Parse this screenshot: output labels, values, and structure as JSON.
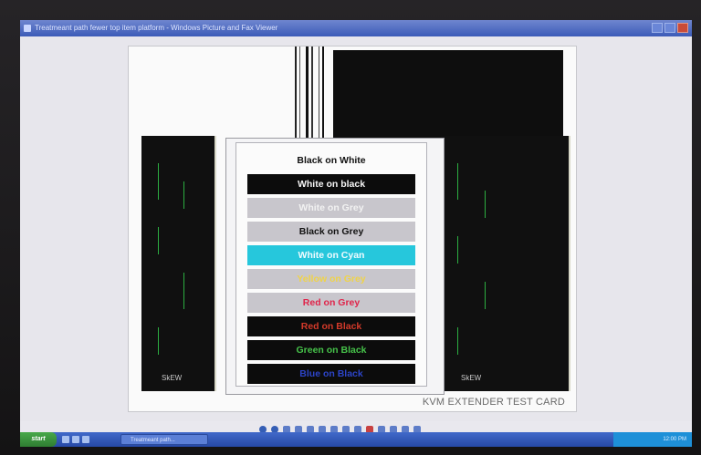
{
  "window": {
    "title": "Treatmeant path fewer top item platform - Windows Picture and Fax Viewer"
  },
  "test_card": {
    "label": "KVM EXTENDER TEST CARD",
    "skew_label": "SkEW",
    "bars": [
      {
        "text": "Black on White",
        "fg": "#111111",
        "bg": "#fbfbfb"
      },
      {
        "text": "White on black",
        "fg": "#f5f5f5",
        "bg": "#0c0c0c"
      },
      {
        "text": "White on Grey",
        "fg": "#f2f2f2",
        "bg": "#c8c6cc"
      },
      {
        "text": "Black on Grey",
        "fg": "#111111",
        "bg": "#c8c6cc"
      },
      {
        "text": "White on Cyan",
        "fg": "#f0fbff",
        "bg": "#26c7dc"
      },
      {
        "text": "Yellow on Grey",
        "fg": "#efd34a",
        "bg": "#c8c6cc"
      },
      {
        "text": "Red on Grey",
        "fg": "#e0244a",
        "bg": "#c8c6cc"
      },
      {
        "text": "Red on Black",
        "fg": "#d43a2a",
        "bg": "#0c0c0c"
      },
      {
        "text": "Green on Black",
        "fg": "#46c24a",
        "bg": "#0c0c0c"
      },
      {
        "text": "Blue on Black",
        "fg": "#2c44c8",
        "bg": "#0c0c0c"
      }
    ]
  },
  "viewer_controls": [
    {
      "icon": "previous-image-icon"
    },
    {
      "icon": "next-image-icon"
    },
    {
      "icon": "best-fit-icon"
    },
    {
      "icon": "actual-size-icon"
    },
    {
      "icon": "slideshow-icon"
    },
    {
      "icon": "zoom-in-icon"
    },
    {
      "icon": "zoom-out-icon"
    },
    {
      "icon": "rotate-clockwise-icon"
    },
    {
      "icon": "rotate-counterclockwise-icon"
    },
    {
      "icon": "delete-icon"
    },
    {
      "icon": "print-icon"
    },
    {
      "icon": "copy-to-icon"
    },
    {
      "icon": "edit-icon"
    },
    {
      "icon": "help-icon"
    }
  ],
  "taskbar": {
    "start_label": "start",
    "task_label": "Treatmeant path...",
    "clock": "12:00 PM"
  }
}
